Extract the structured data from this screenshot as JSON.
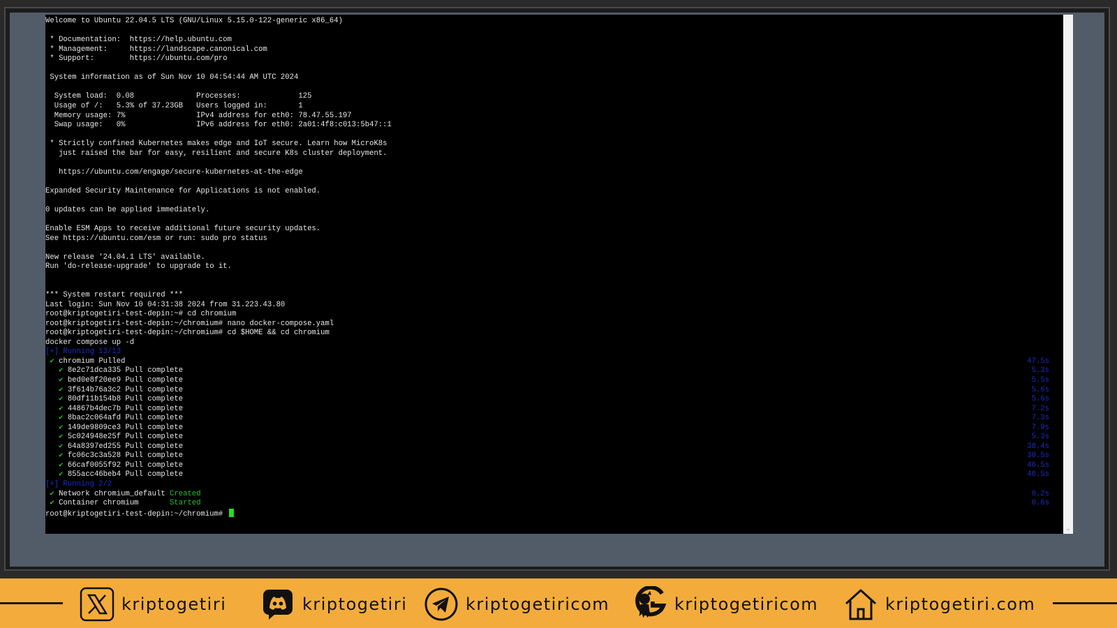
{
  "terminal": {
    "lines": [
      "Welcome to Ubuntu 22.04.5 LTS (GNU/Linux 5.15.0-122-generic x86_64)",
      "",
      " * Documentation:  https://help.ubuntu.com",
      " * Management:     https://landscape.canonical.com",
      " * Support:        https://ubuntu.com/pro",
      "",
      " System information as of Sun Nov 10 04:54:44 AM UTC 2024",
      "",
      "  System load:  0.08              Processes:             125",
      "  Usage of /:   5.3% of 37.23GB   Users logged in:       1",
      "  Memory usage: 7%                IPv4 address for eth0: 78.47.55.197",
      "  Swap usage:   0%                IPv6 address for eth0: 2a01:4f8:c013:5b47::1",
      "",
      " * Strictly confined Kubernetes makes edge and IoT secure. Learn how MicroK8s",
      "   just raised the bar for easy, resilient and secure K8s cluster deployment.",
      "",
      "   https://ubuntu.com/engage/secure-kubernetes-at-the-edge",
      "",
      "Expanded Security Maintenance for Applications is not enabled.",
      "",
      "0 updates can be applied immediately.",
      "",
      "Enable ESM Apps to receive additional future security updates.",
      "See https://ubuntu.com/esm or run: sudo pro status",
      "",
      "New release '24.04.1 LTS' available.",
      "Run 'do-release-upgrade' to upgrade to it.",
      "",
      "",
      "*** System restart required ***",
      "Last login: Sun Nov 10 04:31:38 2024 from 31.223.43.80",
      "root@kriptogetiri-test-depin:~# cd chromium",
      "root@kriptogetiri-test-depin:~/chromium# nano docker-compose.yaml",
      "root@kriptogetiri-test-depin:~/chromium# cd $HOME && cd chromium",
      "docker compose up -d"
    ],
    "pull_header": "[+] Running 13/13",
    "pulled": {
      "name": "chromium",
      "status": "Pulled",
      "duration": "47.5s"
    },
    "layers": [
      {
        "id": "8e2c71dca335",
        "status": "Pull complete",
        "duration": "5.3s"
      },
      {
        "id": "bed0e8f20ee9",
        "status": "Pull complete",
        "duration": "5.5s"
      },
      {
        "id": "3f614b76a3c2",
        "status": "Pull complete",
        "duration": "5.6s"
      },
      {
        "id": "80df11b154b8",
        "status": "Pull complete",
        "duration": "5.6s"
      },
      {
        "id": "44867b4dec7b",
        "status": "Pull complete",
        "duration": "7.2s"
      },
      {
        "id": "8bac2c064afd",
        "status": "Pull complete",
        "duration": "7.3s"
      },
      {
        "id": "149de9809ce3",
        "status": "Pull complete",
        "duration": "7.9s"
      },
      {
        "id": "5c024948e25f",
        "status": "Pull complete",
        "duration": "5.3s"
      },
      {
        "id": "64a8397ed255",
        "status": "Pull complete",
        "duration": "38.4s"
      },
      {
        "id": "fc06c3c3a528",
        "status": "Pull complete",
        "duration": "38.5s"
      },
      {
        "id": "66caf0055f92",
        "status": "Pull complete",
        "duration": "46.5s"
      },
      {
        "id": "855acc46beb4",
        "status": "Pull complete",
        "duration": "46.5s"
      }
    ],
    "run_header": "[+] Running 2/2",
    "resources": [
      {
        "label": "Network chromium_default ",
        "status": "Created",
        "duration": "0.2s"
      },
      {
        "label": "Container chromium       ",
        "status": "Started",
        "duration": "0.6s"
      }
    ],
    "prompt": "root@kriptogetiri-test-depin:~/chromium# ",
    "check": "✔"
  },
  "footer": {
    "socials": [
      {
        "icon": "x-twitter-icon",
        "handle": "kriptogetiri"
      },
      {
        "icon": "discord-icon",
        "handle": "kriptogetiri"
      },
      {
        "icon": "telegram-icon",
        "handle": "kriptogetiricom"
      },
      {
        "icon": "github-icon",
        "handle": "kriptogetiricom"
      },
      {
        "icon": "home-icon",
        "handle": "kriptogetiri.com"
      }
    ]
  }
}
